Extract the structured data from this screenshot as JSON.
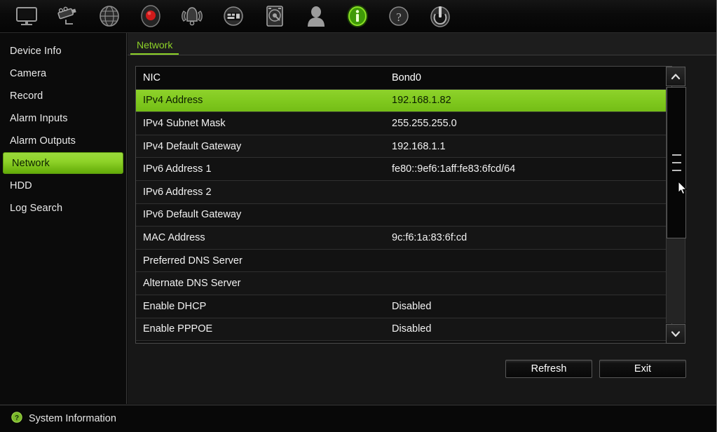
{
  "toolbar": {
    "items": [
      {
        "name": "monitor-icon",
        "label": "Display"
      },
      {
        "name": "camera-icon",
        "label": "Camera"
      },
      {
        "name": "globe-icon",
        "label": "Network"
      },
      {
        "name": "record-icon",
        "label": "Record"
      },
      {
        "name": "alarm-icon",
        "label": "Alarm"
      },
      {
        "name": "playback-icon",
        "label": "Playback"
      },
      {
        "name": "hdd-icon",
        "label": "HDD"
      },
      {
        "name": "user-icon",
        "label": "User"
      },
      {
        "name": "info-icon",
        "label": "System Information"
      },
      {
        "name": "help-icon",
        "label": "Help"
      },
      {
        "name": "power-icon",
        "label": "Shutdown"
      }
    ]
  },
  "sidebar": {
    "items": [
      {
        "label": "Device Info",
        "selected": false
      },
      {
        "label": "Camera",
        "selected": false
      },
      {
        "label": "Record",
        "selected": false
      },
      {
        "label": "Alarm Inputs",
        "selected": false
      },
      {
        "label": "Alarm Outputs",
        "selected": false
      },
      {
        "label": "Network",
        "selected": true
      },
      {
        "label": "HDD",
        "selected": false
      },
      {
        "label": "Log Search",
        "selected": false
      }
    ]
  },
  "tabs": [
    {
      "label": "Network",
      "active": true
    }
  ],
  "table": {
    "rows": [
      {
        "key": "NIC",
        "value": "Bond0",
        "header": true,
        "selected": false
      },
      {
        "key": "IPv4 Address",
        "value": "192.168.1.82",
        "header": false,
        "selected": true
      },
      {
        "key": "IPv4 Subnet Mask",
        "value": "255.255.255.0",
        "header": false,
        "selected": false
      },
      {
        "key": "IPv4 Default Gateway",
        "value": "192.168.1.1",
        "header": false,
        "selected": false
      },
      {
        "key": "IPv6 Address 1",
        "value": "fe80::9ef6:1aff:fe83:6fcd/64",
        "header": false,
        "selected": false
      },
      {
        "key": "IPv6 Address 2",
        "value": "",
        "header": false,
        "selected": false
      },
      {
        "key": "IPv6 Default Gateway",
        "value": "",
        "header": false,
        "selected": false
      },
      {
        "key": "MAC Address",
        "value": "9c:f6:1a:83:6f:cd",
        "header": false,
        "selected": false
      },
      {
        "key": "Preferred DNS Server",
        "value": "",
        "header": false,
        "selected": false
      },
      {
        "key": "Alternate DNS Server",
        "value": "",
        "header": false,
        "selected": false
      },
      {
        "key": "Enable DHCP",
        "value": "Disabled",
        "header": false,
        "selected": false
      },
      {
        "key": "Enable PPPOE",
        "value": "Disabled",
        "header": false,
        "selected": false
      }
    ]
  },
  "scrollbar": {
    "up_arrow": "▲",
    "down_arrow": "▼"
  },
  "buttons": {
    "refresh": "Refresh",
    "exit": "Exit"
  },
  "statusbar": {
    "icon": "help-circle-icon",
    "label": "System Information"
  },
  "colors": {
    "accent_green": "#8ed228",
    "selection_green": "#7fc81e",
    "background": "#0c0c0c",
    "panel": "#171717",
    "text": "#f2f2f2"
  }
}
